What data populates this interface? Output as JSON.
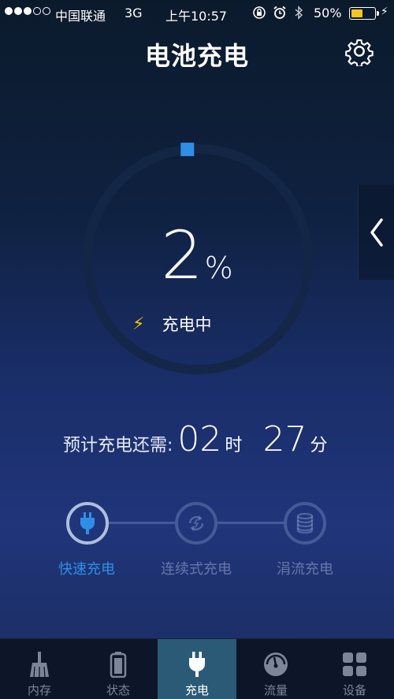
{
  "status_bar": {
    "carrier": "中国联通",
    "network": "3G",
    "time": "上午10:57",
    "battery_percent": "50%",
    "battery_level": 0.5
  },
  "header": {
    "title": "电池充电"
  },
  "battery": {
    "percent_value": "2",
    "percent_unit": "%",
    "status": "充电中",
    "progress": 0.02
  },
  "estimate": {
    "label": "预计充电还需:",
    "hours": "02",
    "hours_unit": "时",
    "minutes": "27",
    "minutes_unit": "分"
  },
  "stages": [
    {
      "label": "快速充电",
      "icon": "plug-icon",
      "active": true
    },
    {
      "label": "连续式充电",
      "icon": "cycle-icon",
      "active": false
    },
    {
      "label": "涓流充电",
      "icon": "coil-icon",
      "active": false
    }
  ],
  "tabbar": [
    {
      "label": "内存",
      "icon": "broom-icon",
      "active": false
    },
    {
      "label": "状态",
      "icon": "battery-icon",
      "active": false
    },
    {
      "label": "充电",
      "icon": "plug-icon",
      "active": true
    },
    {
      "label": "流量",
      "icon": "gauge-icon",
      "active": false
    },
    {
      "label": "设备",
      "icon": "grid-icon",
      "active": false
    }
  ],
  "colors": {
    "accent": "#2f8fe6",
    "bolt": "#f2c300",
    "battery_fill": "#f3c623",
    "tab_active": "#2b5a76"
  }
}
